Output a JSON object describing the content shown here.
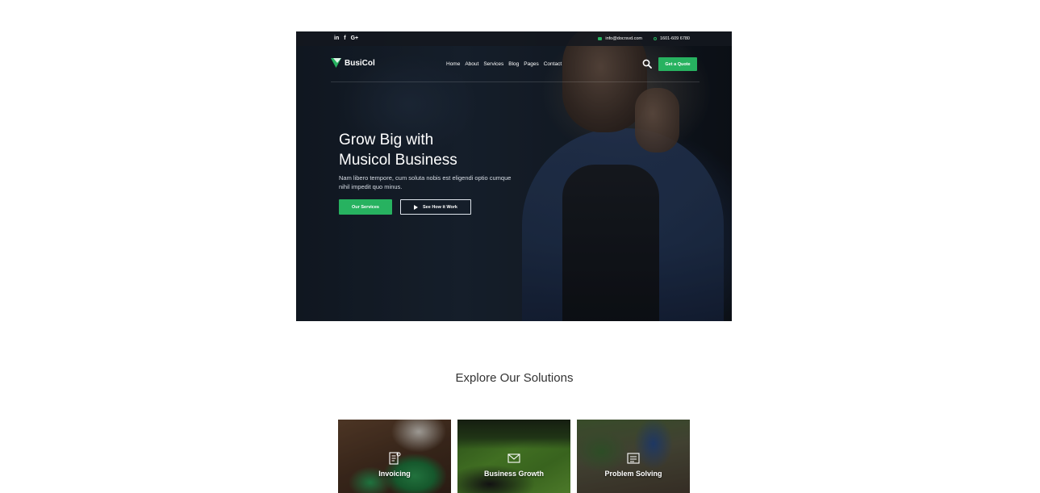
{
  "hero": {
    "topbar": {
      "social": [
        "in",
        "f",
        "G+"
      ],
      "email": "info@docrsvd.com",
      "phone": "1601-609 6780"
    },
    "brand": "BusiCol",
    "menu": [
      "Home",
      "About",
      "Services",
      "Blog",
      "Pages",
      "Contact"
    ],
    "quote_button": "Get a Quote",
    "title_line1": "Grow Big with",
    "title_line2": "Musicol Business",
    "description": "Nam libero tempore, cum soluta nobis est eligendi optio cumque nihil impedit quo minus.",
    "primary_button": "Our Services",
    "secondary_button": "See How it Work"
  },
  "solutions": {
    "title": "Explore Our Solutions",
    "cards": [
      {
        "label": "Invoicing",
        "icon": "invoice-icon"
      },
      {
        "label": "Business Growth",
        "icon": "envelope-icon"
      },
      {
        "label": "Problem Solving",
        "icon": "checklist-icon"
      }
    ]
  },
  "colors": {
    "accent": "#27b260",
    "hero_bg": "#17202b"
  }
}
